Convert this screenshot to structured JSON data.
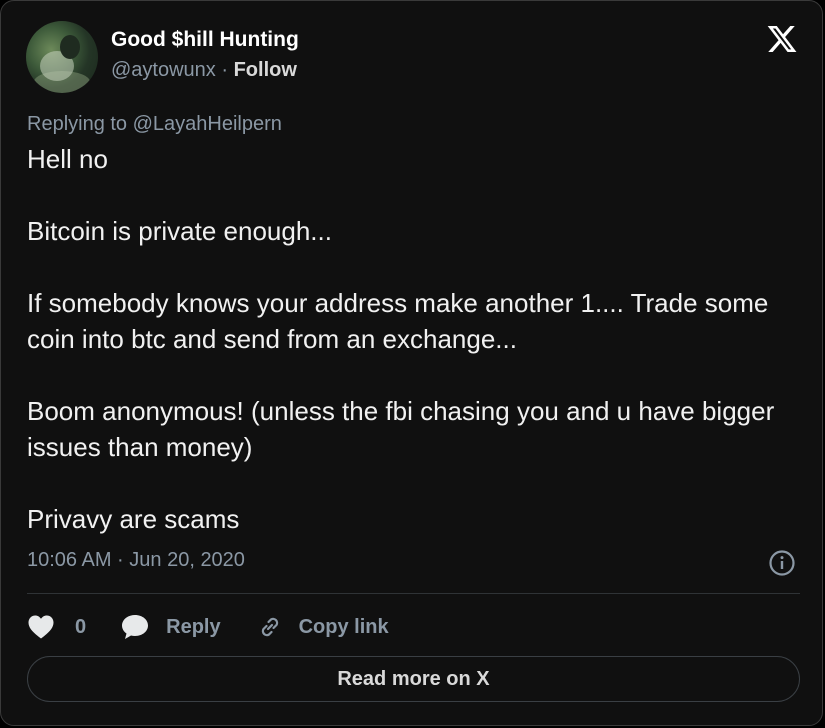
{
  "author": {
    "display_name": "Good $hill Hunting",
    "handle": "@aytowunx",
    "separator": "·",
    "follow_label": "Follow"
  },
  "reply_context": "Replying to @LayahHeilpern",
  "tweet": {
    "paragraphs": [
      "Hell no",
      "Bitcoin is private enough...",
      "If somebody knows your address make another 1.... Trade some coin into btc and send from an exchange...",
      "Boom anonymous! (unless the fbi chasing you and u have bigger issues than money)",
      "Privavy are scams"
    ],
    "timestamp": "10:06 AM · Jun 20, 2020"
  },
  "actions": {
    "like_count": "0",
    "reply_label": "Reply",
    "copy_label": "Copy link"
  },
  "read_more_label": "Read more on X",
  "icons": {
    "brand": "x-logo-icon",
    "info": "info-icon",
    "like": "heart-icon",
    "reply": "speech-bubble-icon",
    "copy": "link-icon"
  },
  "colors": {
    "background": "#101010",
    "text": "#e7e9ea",
    "muted": "#8b98a5"
  }
}
